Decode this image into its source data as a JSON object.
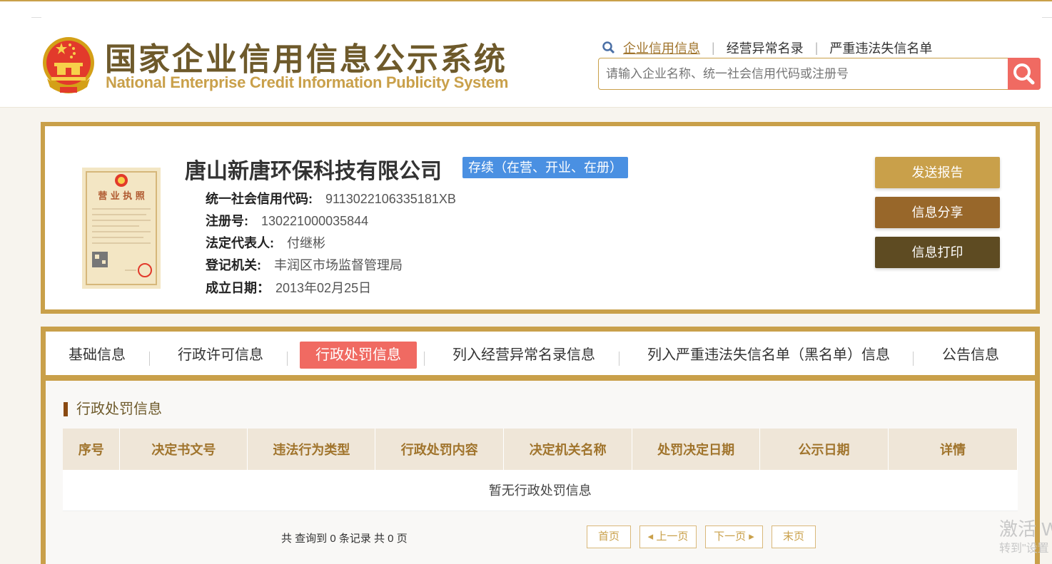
{
  "header": {
    "title_cn": "国家企业信用信息公示系统",
    "title_en": "National Enterprise Credit Information Publicity System",
    "links": [
      "企业信用信息",
      "经营异常名录",
      "严重违法失信名单"
    ],
    "search_placeholder": "请输入企业名称、统一社会信用代码或注册号"
  },
  "company": {
    "name": "唐山新唐环保科技有限公司",
    "status": "存续（在营、开业、在册）",
    "license_label": "营业执照",
    "fields": [
      {
        "label": "统一社会信用代码:",
        "value": "9113022106335181XB"
      },
      {
        "label": "注册号:",
        "value": "130221000035844"
      },
      {
        "label": "法定代表人:",
        "value": "付继彬"
      },
      {
        "label": "登记机关:",
        "value": "丰润区市场监督管理局"
      },
      {
        "label": "成立日期：",
        "value": "2013年02月25日"
      }
    ],
    "buttons": [
      "发送报告",
      "信息分享",
      "信息打印"
    ]
  },
  "tabs": [
    "基础信息",
    "行政许可信息",
    "行政处罚信息",
    "列入经营异常名录信息",
    "列入严重违法失信名单（黑名单）信息",
    "公告信息"
  ],
  "section": {
    "title": "行政处罚信息",
    "columns": [
      "序号",
      "决定书文号",
      "违法行为类型",
      "行政处罚内容",
      "决定机关名称",
      "处罚决定日期",
      "公示日期",
      "详情"
    ],
    "empty_text": "暂无行政处罚信息"
  },
  "pager": {
    "info": "共 查询到 0 条记录 共 0 页",
    "first": "首页",
    "prev": "◂ 上一页",
    "next": "下一页 ▸",
    "last": "末页"
  },
  "watermark": {
    "line1": "激活 W",
    "line2": "转到\"设置"
  },
  "colors": {
    "gold": "#c9a04a",
    "brown": "#6e5a2b",
    "accent": "#f06a62",
    "status_blue": "#4a90e2",
    "btn1": "#c9a04a",
    "btn2": "#98672a",
    "btn3": "#5e4b22"
  }
}
